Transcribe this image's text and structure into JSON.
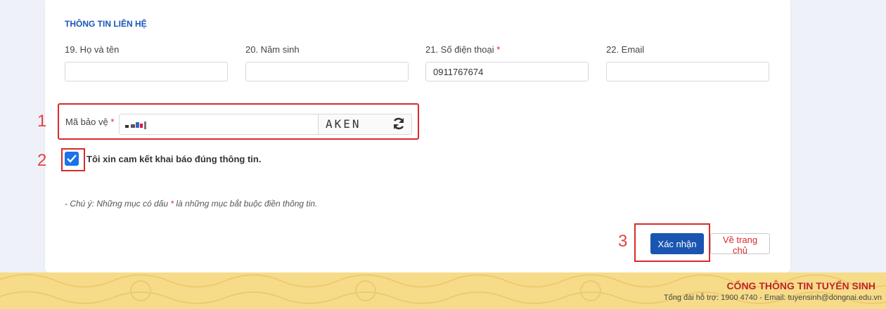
{
  "section": {
    "title": "THÔNG TIN LIÊN HỆ"
  },
  "fields": [
    {
      "label": "19. Họ và tên",
      "required": false,
      "value": ""
    },
    {
      "label": "20. Năm sinh",
      "required": false,
      "value": ""
    },
    {
      "label": "21. Số điện thoại",
      "required": true,
      "value": "0911767674"
    },
    {
      "label": "22. Email",
      "required": false,
      "value": ""
    }
  ],
  "captcha": {
    "label": "Mã bảo vệ",
    "required_mark": "*",
    "image_text": "AKEN",
    "refresh_icon": "refresh-icon"
  },
  "agreement": {
    "checked": true,
    "label": "Tôi xin cam kết khai báo đúng thông tin."
  },
  "note": {
    "prefix": "- Chú ý: Những mục có dấu ",
    "mark": "*",
    "suffix": " là những mục bắt buộc điền thông tin."
  },
  "buttons": {
    "submit": "Xác nhận",
    "home": "Về trang chủ"
  },
  "markers": [
    "1",
    "2",
    "3"
  ],
  "footer": {
    "title": "CỔNG THÔNG TIN TUYỂN SINH",
    "subtitle": "Tổng đài hỗ trợ: 1900 4740 - Email: tuyensinh@dongnai.edu.vn"
  },
  "colors": {
    "accent": "#1a56b8",
    "required": "#e02424",
    "highlight": "#d92a2a",
    "footer_bg": "#f6dc89"
  }
}
